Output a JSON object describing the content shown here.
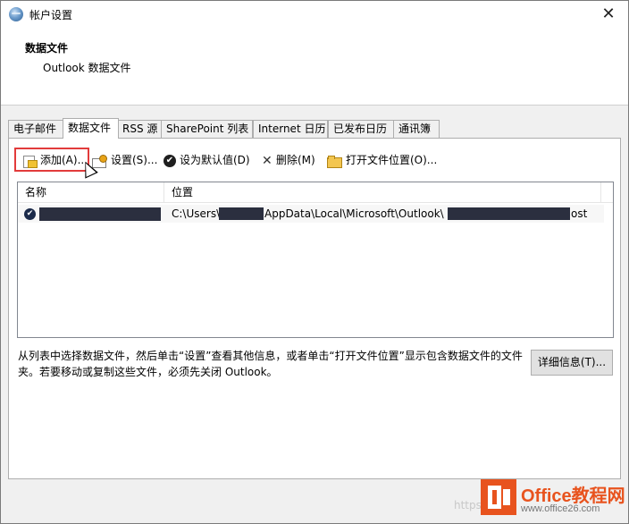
{
  "window": {
    "title": "帐户设置",
    "close_glyph": "✕"
  },
  "header": {
    "title": "数据文件",
    "subtitle": "Outlook 数据文件"
  },
  "tabs": [
    {
      "label": "电子邮件"
    },
    {
      "label": "数据文件",
      "active": true
    },
    {
      "label": "RSS 源"
    },
    {
      "label": "SharePoint 列表"
    },
    {
      "label": "Internet 日历"
    },
    {
      "label": "已发布日历"
    },
    {
      "label": "通讯簿"
    }
  ],
  "toolbar": {
    "add_label": "添加(A)...",
    "settings_label": "设置(S)...",
    "default_label": "设为默认值(D)",
    "remove_label": "删除(M)",
    "open_location_label": "打开文件位置(O)..."
  },
  "list": {
    "columns": {
      "name": "名称",
      "location": "位置"
    },
    "rows": [
      {
        "default": true,
        "path_part1": "C:\\Users\\",
        "path_part2": "AppData\\Local\\Microsoft\\Outlook\\",
        "path_part3": "ost"
      }
    ]
  },
  "description": "从列表中选择数据文件，然后单击“设置”查看其他信息，或者单击“打开文件位置”显示包含数据文件的文件夹。若要移动或复制这些文件，必须先关闭 Outlook。",
  "details_button_label": "详细信息(T)...",
  "watermark": {
    "logo_title": "Office教程网",
    "logo_url": "www.office26.com",
    "text": "https"
  },
  "colors": {
    "highlight": "#e23b3b",
    "logo": "#e8531e"
  },
  "icons": {
    "add": "add-data-file-icon",
    "settings": "settings-icon",
    "default": "checkmark-circle-icon",
    "remove": "x-icon",
    "open": "folder-icon",
    "close": "close-icon"
  }
}
